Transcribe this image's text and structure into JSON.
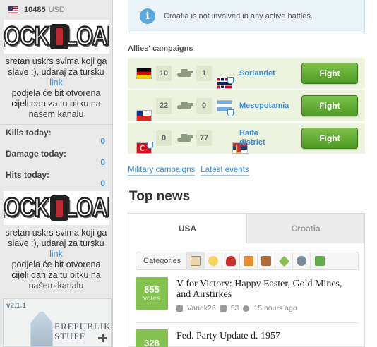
{
  "sidebar": {
    "money": {
      "amount": "10485",
      "currency": "USD"
    },
    "logo_text": "LOCK N LOAD",
    "promo": {
      "line1": "sretan uskrs svima koji ga slave :), udaraj za tursku",
      "link": "link",
      "line2": "podjela će bit otvorena cijeli dan za tu bitku na našem kanalu"
    },
    "stats": [
      {
        "label": "Kills today:",
        "value": "0"
      },
      {
        "label": "Damage today:",
        "value": "0"
      },
      {
        "label": "Hits today:",
        "value": "0"
      }
    ],
    "stuff": {
      "version": "v2.1.1",
      "name_line1": "EREPUBLIK",
      "name_line2": "STUFF"
    }
  },
  "main": {
    "info": "Croatia is not involved in any active battles.",
    "campaigns_title": "Allies' campaigns",
    "campaigns": [
      {
        "left_flag": "Germany",
        "left_count": "10",
        "right_count": "1",
        "right_flag": "Norway",
        "region": "Sorlandet",
        "button": "Fight"
      },
      {
        "left_flag": "Chile",
        "left_count": "22",
        "right_count": "0",
        "right_flag": "Argentina",
        "region": "Mesopotamia",
        "button": "Fight"
      },
      {
        "left_flag": "Turkey",
        "left_count": "0",
        "right_count": "77",
        "right_flag": "Serbia",
        "region": "Haifa district",
        "region_line1": "Haifa",
        "region_line2": "district",
        "button": "Fight"
      }
    ],
    "links": {
      "military": "Military campaigns",
      "events": "Latest events"
    },
    "top_news": "Top news",
    "tabs": {
      "active": "USA",
      "inactive": "Croatia"
    },
    "categories_label": "Categories",
    "category_icons": [
      "first-steps-icon",
      "battle-orders-icon",
      "warfare-icon",
      "political-icon",
      "financial-icon",
      "social-icon",
      "interviews-icon",
      "fun-icon"
    ],
    "articles": [
      {
        "votes": "855",
        "votes_label": "votes",
        "title": "V for Victory: Happy Easter, Gold Mines, and Airstirkes",
        "author": "Vanek26",
        "comments": "53",
        "time": "15 hours ago"
      },
      {
        "votes": "328",
        "title": "Fed. Party Update d. 1957"
      }
    ]
  }
}
